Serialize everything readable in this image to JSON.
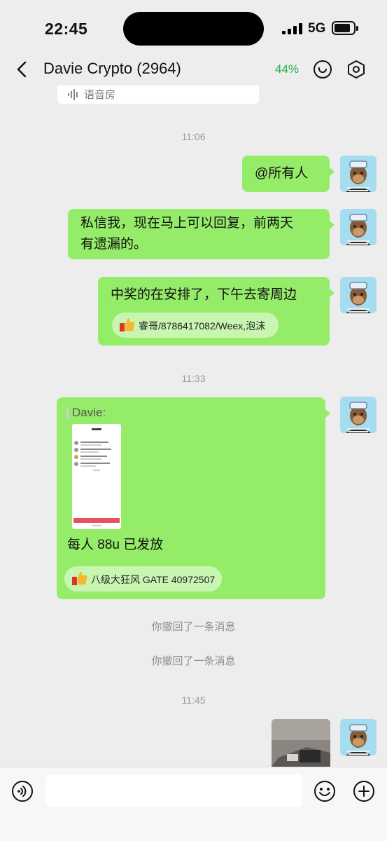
{
  "status": {
    "time": "22:45",
    "network": "5G"
  },
  "nav": {
    "title": "Davie Crypto (2964)",
    "percent": "44%"
  },
  "voice_room": {
    "label": "语音房"
  },
  "timestamps": [
    "11:06",
    "11:33",
    "11:45"
  ],
  "messages": [
    {
      "text": "@所有人"
    },
    {
      "text_line1": "私信我，现在马上可以回复，前两天",
      "text_line2": "有遗漏的。"
    },
    {
      "text": "中奖的在安排了，下午去寄周边",
      "tag": "睿哥/8786417082/Weex,泡沫"
    },
    {
      "quote": "Davie:",
      "text": "每人 88u 已发放",
      "tag": "八级大狂风 GATE 40972507"
    }
  ],
  "system": [
    "你撤回了一条消息",
    "你撤回了一条消息"
  ],
  "colors": {
    "bubble": "#95ec69",
    "accent": "#23b14d",
    "background": "#ededed"
  },
  "icons": [
    "back-icon",
    "emoji-circle-icon",
    "settings-hex-icon",
    "voice-icon",
    "emoji-icon",
    "plus-icon"
  ]
}
